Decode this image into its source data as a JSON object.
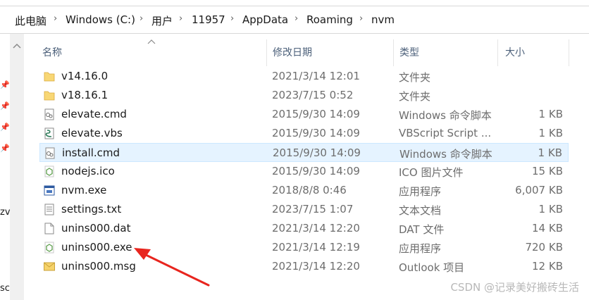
{
  "breadcrumb": {
    "items": [
      "此电脑",
      "Windows (C:)",
      "用户",
      "11957",
      "AppData",
      "Roaming",
      "nvm"
    ],
    "separator": "›"
  },
  "left_pane": {
    "partial_texts": [
      "zv",
      "sc"
    ]
  },
  "columns": {
    "name": "名称",
    "date": "修改日期",
    "type": "类型",
    "size": "大小"
  },
  "files": [
    {
      "name": "v14.16.0",
      "date": "2021/3/14 12:01",
      "type": "文件夹",
      "size": "",
      "icon": "folder-icon"
    },
    {
      "name": "v18.16.1",
      "date": "2023/7/15 0:52",
      "type": "文件夹",
      "size": "",
      "icon": "folder-icon"
    },
    {
      "name": "elevate.cmd",
      "date": "2015/9/30 14:09",
      "type": "Windows 命令脚本",
      "size": "1 KB",
      "icon": "cmd-script-icon"
    },
    {
      "name": "elevate.vbs",
      "date": "2015/9/30 14:09",
      "type": "VBScript Script ...",
      "size": "1 KB",
      "icon": "vbscript-icon"
    },
    {
      "name": "install.cmd",
      "date": "2015/9/30 14:09",
      "type": "Windows 命令脚本",
      "size": "1 KB",
      "icon": "cmd-script-icon",
      "selected": true
    },
    {
      "name": "nodejs.ico",
      "date": "2015/9/30 14:09",
      "type": "ICO 图片文件",
      "size": "15 KB",
      "icon": "nodejs-icon"
    },
    {
      "name": "nvm.exe",
      "date": "2018/8/8 0:46",
      "type": "应用程序",
      "size": "6,007 KB",
      "icon": "application-icon"
    },
    {
      "name": "settings.txt",
      "date": "2023/7/15 1:07",
      "type": "文本文档",
      "size": "1 KB",
      "icon": "text-file-icon"
    },
    {
      "name": "unins000.dat",
      "date": "2021/3/14 12:20",
      "type": "DAT 文件",
      "size": "14 KB",
      "icon": "blank-file-icon"
    },
    {
      "name": "unins000.exe",
      "date": "2021/3/14 12:19",
      "type": "应用程序",
      "size": "720 KB",
      "icon": "nodejs-icon"
    },
    {
      "name": "unins000.msg",
      "date": "2021/3/14 12:20",
      "type": "Outlook 项目",
      "size": "12 KB",
      "icon": "mail-icon"
    }
  ],
  "watermark": "CSDN @记录美好搬砖生活",
  "colors": {
    "selection": "#e5f3ff",
    "arrow": "#e8251e",
    "folder": "#f8d775"
  }
}
